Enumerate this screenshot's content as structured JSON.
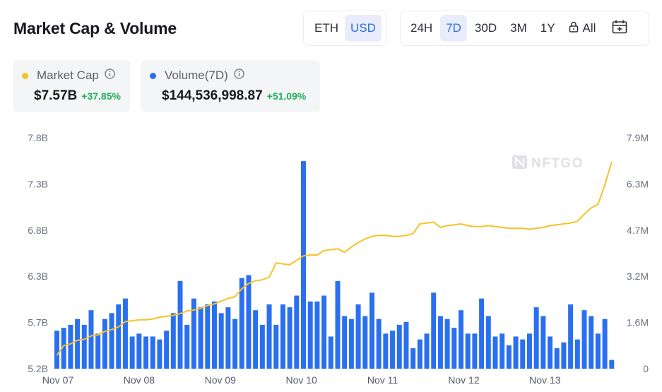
{
  "header": {
    "title": "Market Cap & Volume"
  },
  "currency_toggle": {
    "options": [
      "ETH",
      "USD"
    ],
    "selected": "USD"
  },
  "range_toggle": {
    "options": [
      "24H",
      "7D",
      "30D",
      "3M",
      "1Y",
      "All"
    ],
    "selected": "7D",
    "locked": [
      "All"
    ]
  },
  "icons": {
    "lock": "lock-icon",
    "calendar": "calendar-icon",
    "info": "info-icon",
    "watermark": "nftgo-logo"
  },
  "stats": {
    "market_cap": {
      "label": "Market Cap",
      "value": "$7.57B",
      "change": "+37.85%",
      "color": "#f7c227"
    },
    "volume": {
      "label": "Volume(7D)",
      "value": "$144,536,998.87",
      "change": "+51.09%",
      "color": "#2a6ff0"
    }
  },
  "watermark": "NFTGO",
  "chart_data": {
    "type": "bar+line",
    "x_tick_labels": [
      "Nov 07",
      "Nov 08",
      "Nov 09",
      "Nov 10",
      "Nov 11",
      "Nov 12",
      "Nov 13"
    ],
    "left_axis": {
      "series": "Market Cap",
      "ticks": [
        "5.2B",
        "5.7B",
        "6.3B",
        "6.8B",
        "7.3B",
        "7.8B"
      ],
      "range": [
        5.2,
        7.8
      ],
      "unit": "B"
    },
    "right_axis": {
      "series": "Volume(7D)",
      "ticks": [
        "0",
        "1.6M",
        "3.2M",
        "4.7M",
        "6.3M",
        "7.9M"
      ],
      "range": [
        0,
        7.9
      ],
      "unit": "M"
    },
    "series": [
      {
        "name": "Volume(7D)",
        "kind": "bar",
        "color": "#2a6ff0",
        "values_M": [
          1.3,
          1.4,
          1.5,
          1.7,
          1.5,
          2.0,
          1.2,
          1.7,
          1.9,
          2.2,
          2.4,
          1.1,
          1.2,
          1.1,
          1.1,
          1.0,
          1.3,
          1.9,
          3.0,
          1.5,
          2.4,
          2.1,
          2.2,
          2.3,
          1.9,
          2.1,
          1.7,
          3.1,
          3.2,
          2.0,
          1.5,
          2.2,
          1.5,
          2.2,
          2.1,
          2.5,
          7.1,
          2.3,
          2.3,
          2.5,
          1.1,
          3.0,
          1.8,
          1.7,
          2.2,
          1.8,
          2.6,
          1.7,
          1.2,
          1.3,
          1.5,
          1.6,
          0.7,
          1.0,
          1.2,
          2.6,
          1.8,
          1.7,
          1.4,
          2.0,
          1.2,
          1.2,
          2.4,
          1.8,
          1.1,
          1.2,
          0.8,
          1.1,
          1.0,
          1.2,
          2.1,
          1.8,
          1.1,
          0.7,
          0.9,
          2.2,
          1.0,
          2.0,
          1.8,
          1.2,
          1.7,
          0.3
        ]
      },
      {
        "name": "Market Cap",
        "kind": "line",
        "color": "#f7c227",
        "values_B": [
          5.35,
          5.46,
          5.48,
          5.52,
          5.53,
          5.57,
          5.58,
          5.62,
          5.64,
          5.67,
          5.73,
          5.74,
          5.75,
          5.75,
          5.76,
          5.78,
          5.79,
          5.8,
          5.82,
          5.85,
          5.86,
          5.88,
          5.91,
          5.93,
          5.96,
          5.99,
          6.01,
          6.1,
          6.16,
          6.19,
          6.2,
          6.23,
          6.39,
          6.38,
          6.37,
          6.42,
          6.47,
          6.48,
          6.48,
          6.53,
          6.54,
          6.55,
          6.51,
          6.57,
          6.62,
          6.66,
          6.69,
          6.7,
          6.7,
          6.69,
          6.69,
          6.7,
          6.72,
          6.83,
          6.84,
          6.85,
          6.79,
          6.81,
          6.82,
          6.83,
          6.81,
          6.8,
          6.8,
          6.81,
          6.8,
          6.79,
          6.78,
          6.78,
          6.78,
          6.77,
          6.78,
          6.79,
          6.81,
          6.82,
          6.83,
          6.84,
          6.86,
          6.94,
          7.01,
          7.05,
          7.27,
          7.53
        ]
      }
    ],
    "grid": false,
    "legend": "top-left (stat cards)"
  }
}
